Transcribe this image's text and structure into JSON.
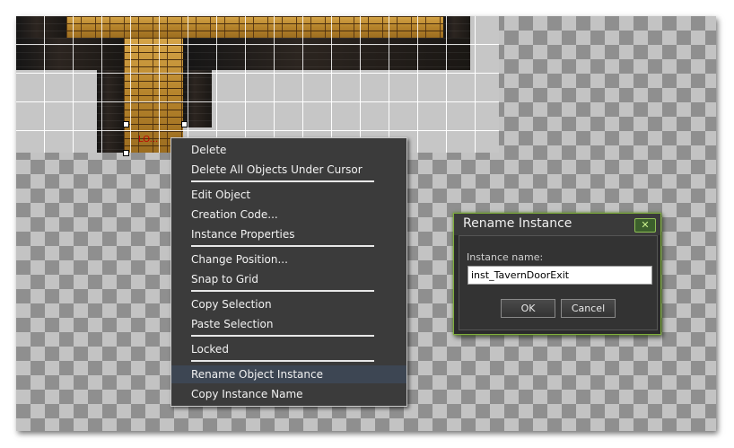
{
  "room": {
    "door_label": "LO..."
  },
  "context_menu": {
    "items": [
      {
        "label": "Delete"
      },
      {
        "label": "Delete All Objects Under Cursor"
      },
      {
        "label": "Edit Object"
      },
      {
        "label": "Creation Code..."
      },
      {
        "label": "Instance Properties"
      },
      {
        "label": "Change Position..."
      },
      {
        "label": "Snap to Grid"
      },
      {
        "label": "Copy Selection"
      },
      {
        "label": "Paste Selection"
      },
      {
        "label": "Locked"
      },
      {
        "label": "Rename Object Instance"
      },
      {
        "label": "Copy Instance Name"
      }
    ],
    "highlighted_index": 10
  },
  "dialog": {
    "title": "Rename Instance",
    "close_icon": "close-icon",
    "field_label": "Instance name:",
    "field_value": "inst_TavernDoorExit",
    "ok_label": "OK",
    "cancel_label": "Cancel"
  },
  "colors": {
    "menu_bg": "#3b3b3b",
    "menu_highlight": "#3d4653",
    "dialog_border": "#7fae3d"
  }
}
